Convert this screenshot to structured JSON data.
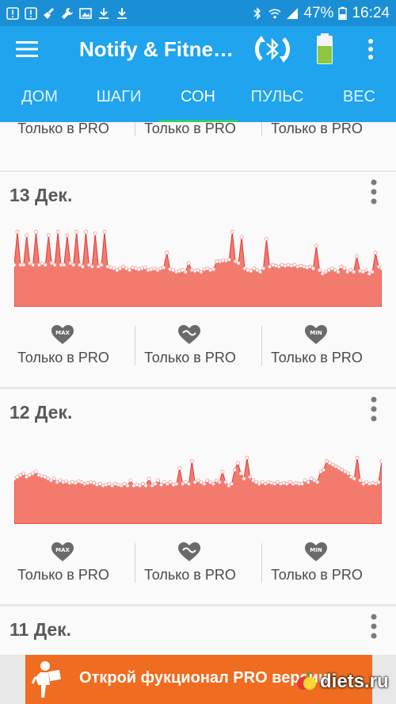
{
  "status": {
    "battery": "47%",
    "time": "16:24"
  },
  "app": {
    "title": "Notify & Fitne…"
  },
  "tabs": [
    "ДОМ",
    "ШАГИ",
    "СОН",
    "ПУЛЬС",
    "ВЕС"
  ],
  "active_tab": "СОН",
  "pro_label": "Только в PRO",
  "heart_icons": {
    "max": "MAX",
    "min": "MIN"
  },
  "cards": [
    {
      "date": "13 Дек."
    },
    {
      "date": "12 Дек."
    },
    {
      "date": "11 Дек."
    }
  ],
  "chart_data": [
    {
      "type": "area",
      "title": "13 Дек.",
      "ylim": [
        0,
        100
      ],
      "values": [
        48,
        86,
        48,
        48,
        82,
        50,
        48,
        86,
        48,
        50,
        48,
        82,
        50,
        48,
        86,
        48,
        48,
        82,
        50,
        48,
        86,
        48,
        46,
        86,
        48,
        46,
        84,
        46,
        48,
        86,
        46,
        45,
        44,
        42,
        44,
        46,
        44,
        42,
        45,
        44,
        43,
        44,
        45,
        42,
        43,
        44,
        42,
        44,
        45,
        62,
        43,
        42,
        40,
        41,
        42,
        40,
        50,
        42,
        41,
        42,
        40,
        43,
        44,
        42,
        43,
        52,
        52,
        53,
        53,
        54,
        86,
        52,
        50,
        80,
        44,
        42,
        41,
        44,
        42,
        40,
        44,
        78,
        46,
        48,
        47,
        46,
        48,
        47,
        48,
        47,
        48,
        46,
        47,
        46,
        45,
        46,
        44,
        70,
        42,
        38,
        40,
        42,
        44,
        42,
        40,
        46,
        44,
        40,
        42,
        40,
        58,
        41,
        40,
        42,
        38,
        40,
        62,
        46,
        44
      ]
    },
    {
      "type": "area",
      "title": "12 Дек.",
      "ylim": [
        0,
        100
      ],
      "values": [
        52,
        54,
        56,
        58,
        54,
        56,
        58,
        60,
        56,
        55,
        54,
        52,
        50,
        52,
        48,
        50,
        48,
        49,
        47,
        48,
        47,
        49,
        48,
        46,
        47,
        48,
        47,
        45,
        46,
        44,
        45,
        46,
        44,
        46,
        45,
        44,
        46,
        44,
        50,
        44,
        45,
        44,
        46,
        44,
        52,
        44,
        46,
        50,
        45,
        48,
        46,
        48,
        45,
        46,
        64,
        46,
        48,
        46,
        72,
        48,
        50,
        48,
        46,
        50,
        48,
        46,
        50,
        48,
        60,
        48,
        44,
        46,
        62,
        70,
        58,
        52,
        76,
        54,
        50,
        48,
        46,
        48,
        46,
        48,
        47,
        46,
        48,
        46,
        47,
        46,
        48,
        46,
        47,
        46,
        46,
        50,
        48,
        52,
        50,
        48,
        60,
        62,
        72,
        70,
        68,
        66,
        64,
        62,
        60,
        58,
        54,
        52,
        76,
        50,
        46,
        48,
        46,
        47,
        46,
        48,
        72
      ]
    }
  ],
  "promo": {
    "text": "Открой фукционал PRO версии"
  },
  "watermark": "diets.ru"
}
